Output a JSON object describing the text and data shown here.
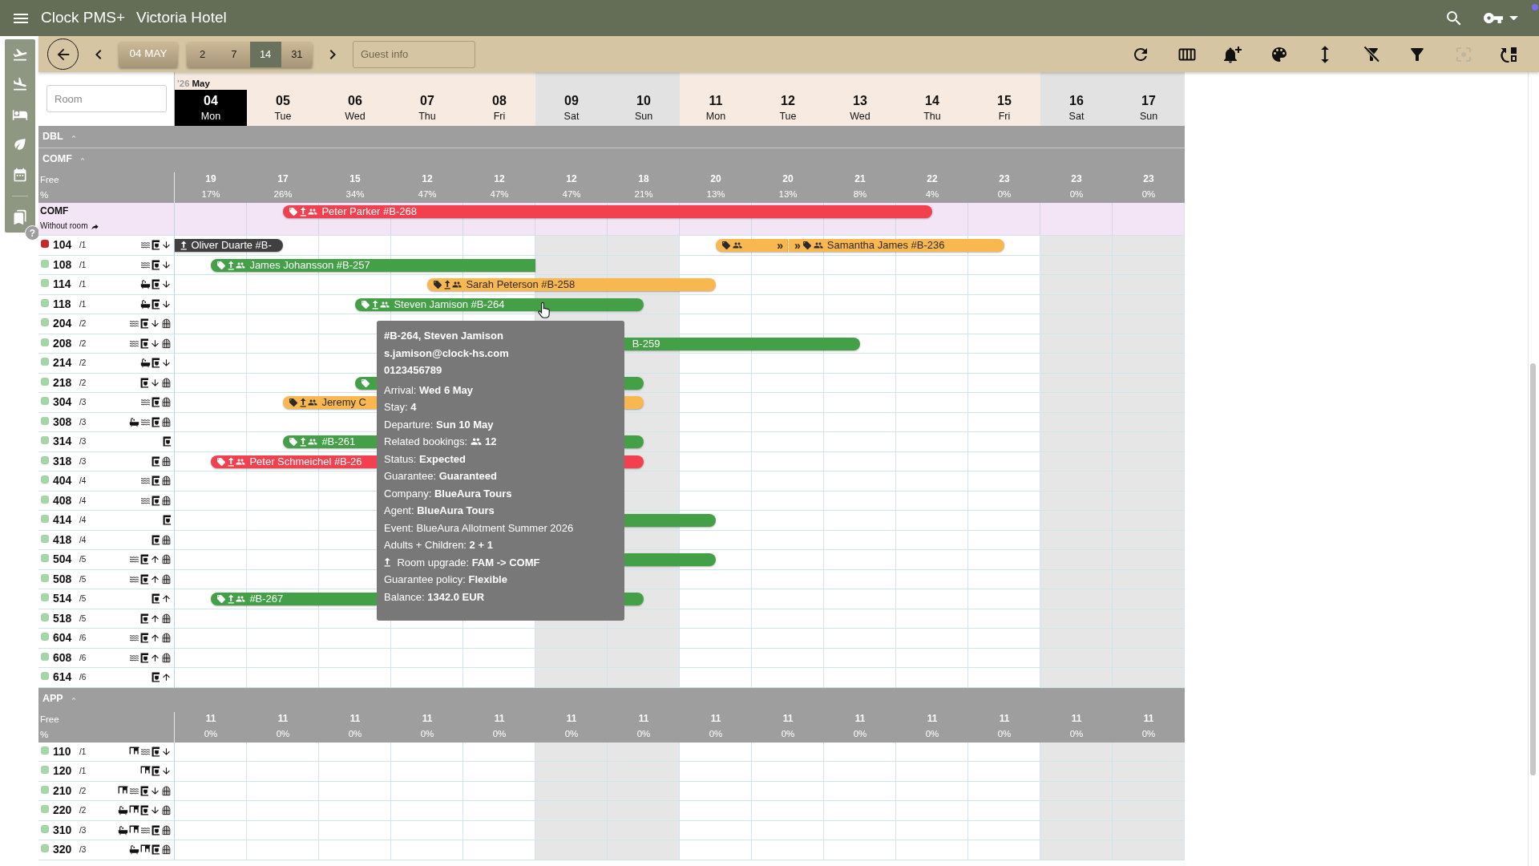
{
  "app_bar": {
    "title": "Clock PMS+",
    "hotel": "Victoria Hotel"
  },
  "sidebar": {
    "items": [
      {
        "kind": "departures"
      },
      {
        "kind": "arrivals"
      },
      {
        "kind": "bed"
      },
      {
        "kind": "leaf"
      },
      {
        "kind": "calendar"
      },
      {
        "kind": "books"
      }
    ],
    "help": "?"
  },
  "toolbar": {
    "date_button": "04 MAY",
    "ranges": [
      {
        "label": "2",
        "selected": false
      },
      {
        "label": "7",
        "selected": false
      },
      {
        "label": "14",
        "selected": true
      },
      {
        "label": "31",
        "selected": false
      }
    ],
    "guest_search": {
      "placeholder": "Guest info"
    },
    "tools": [
      {
        "kind": "refresh",
        "disabled": false
      },
      {
        "kind": "columns",
        "disabled": false
      },
      {
        "kind": "bell-plus",
        "disabled": false
      },
      {
        "kind": "palette",
        "disabled": false
      },
      {
        "kind": "vertical-arrows",
        "disabled": false
      },
      {
        "kind": "filter-off",
        "disabled": false
      },
      {
        "kind": "filter",
        "disabled": false
      },
      {
        "kind": "focus",
        "disabled": true
      },
      {
        "kind": "rotate-layout",
        "disabled": false
      }
    ]
  },
  "calendar": {
    "room_search": {
      "placeholder": "Room"
    },
    "year": "'26",
    "month": "May",
    "days": [
      {
        "day": "04",
        "weekday": "Mon",
        "selected": true,
        "weekend": false
      },
      {
        "day": "05",
        "weekday": "Tue",
        "selected": false,
        "weekend": false
      },
      {
        "day": "06",
        "weekday": "Wed",
        "selected": false,
        "weekend": false
      },
      {
        "day": "07",
        "weekday": "Thu",
        "selected": false,
        "weekend": false
      },
      {
        "day": "08",
        "weekday": "Fri",
        "selected": false,
        "weekend": false
      },
      {
        "day": "09",
        "weekday": "Sat",
        "selected": false,
        "weekend": true
      },
      {
        "day": "10",
        "weekday": "Sun",
        "selected": false,
        "weekend": true
      },
      {
        "day": "11",
        "weekday": "Mon",
        "selected": false,
        "weekend": false
      },
      {
        "day": "12",
        "weekday": "Tue",
        "selected": false,
        "weekend": false
      },
      {
        "day": "13",
        "weekday": "Wed",
        "selected": false,
        "weekend": false
      },
      {
        "day": "14",
        "weekday": "Thu",
        "selected": false,
        "weekend": false
      },
      {
        "day": "15",
        "weekday": "Fri",
        "selected": false,
        "weekend": false
      },
      {
        "day": "16",
        "weekday": "Sat",
        "selected": false,
        "weekend": true
      },
      {
        "day": "17",
        "weekday": "Sun",
        "selected": false,
        "weekend": true
      }
    ]
  },
  "groups": [
    {
      "name": "DBL"
    },
    {
      "name": "COMF",
      "availability": {
        "free_label": "Free",
        "percent_label": "%",
        "cells": [
          {
            "free": "19",
            "percent": "17%"
          },
          {
            "free": "17",
            "percent": "26%"
          },
          {
            "free": "15",
            "percent": "34%"
          },
          {
            "free": "12",
            "percent": "47%"
          },
          {
            "free": "12",
            "percent": "47%"
          },
          {
            "free": "12",
            "percent": "47%"
          },
          {
            "free": "18",
            "percent": "21%"
          },
          {
            "free": "20",
            "percent": "13%"
          },
          {
            "free": "20",
            "percent": "13%"
          },
          {
            "free": "21",
            "percent": "8%"
          },
          {
            "free": "22",
            "percent": "4%"
          },
          {
            "free": "23",
            "percent": "0%"
          },
          {
            "free": "23",
            "percent": "0%"
          },
          {
            "free": "23",
            "percent": "0%"
          }
        ]
      },
      "unassigned": {
        "title": "COMF",
        "subtitle": "Without room",
        "bookings": [
          {
            "label": "Peter Parker #B-268",
            "color": "#f2404e",
            "icons": [
              {
                "kind": "tag"
              },
              {
                "kind": "upgrade"
              },
              {
                "kind": "people"
              }
            ]
          }
        ]
      },
      "rooms": [
        {
          "number": "104",
          "floor": "/1",
          "color": "#c62828",
          "features": [
            {
              "kind": "waves"
            },
            {
              "kind": "coffee-maker"
            },
            {
              "kind": "arrow-down"
            }
          ],
          "bookings": [
            {
              "label": "Oliver Duarte #B-",
              "color": "#404040",
              "icons": [
                {
                  "kind": "upgrade"
                }
              ]
            },
            {
              "color": "#f9b84f",
              "icons": [
                {
                  "kind": "tag"
                },
                {
                  "kind": "people"
                }
              ],
              "end_mark": "»"
            },
            {
              "start_mark": "»",
              "color": "#f9b84f",
              "icons": [
                {
                  "kind": "tag"
                },
                {
                  "kind": "people"
                }
              ],
              "label": "Samantha James #B-236"
            }
          ]
        },
        {
          "number": "108",
          "floor": "/1",
          "color": "#a5d6a7",
          "features": [
            {
              "kind": "waves"
            },
            {
              "kind": "coffee-maker"
            },
            {
              "kind": "arrow-down"
            }
          ],
          "bookings": [
            {
              "label": "James Johansson #B-257",
              "color": "#43a047",
              "icons": [
                {
                  "kind": "tag"
                },
                {
                  "kind": "upgrade"
                },
                {
                  "kind": "people"
                }
              ]
            }
          ]
        },
        {
          "number": "114",
          "floor": "/1",
          "color": "#a5d6a7",
          "features": [
            {
              "kind": "bathtub"
            },
            {
              "kind": "coffee-maker"
            },
            {
              "kind": "arrow-down"
            }
          ],
          "bookings": [
            {
              "label": "Sarah Peterson #B-258",
              "color": "#f9b84f",
              "icons": [
                {
                  "kind": "tag"
                },
                {
                  "kind": "upgrade"
                },
                {
                  "kind": "people"
                }
              ]
            }
          ]
        },
        {
          "number": "118",
          "floor": "/1",
          "color": "#a5d6a7",
          "features": [
            {
              "kind": "bathtub"
            },
            {
              "kind": "coffee-maker"
            },
            {
              "kind": "arrow-down"
            }
          ],
          "bookings": [
            {
              "label": "Steven Jamison #B-264",
              "color": "#43a047",
              "icons": [
                {
                  "kind": "tag"
                },
                {
                  "kind": "upgrade"
                },
                {
                  "kind": "people"
                }
              ]
            }
          ]
        },
        {
          "number": "204",
          "floor": "/2",
          "color": "#a5d6a7",
          "features": [
            {
              "kind": "waves"
            },
            {
              "kind": "coffee-maker"
            },
            {
              "kind": "arrow-down"
            },
            {
              "kind": "window"
            }
          ]
        },
        {
          "number": "208",
          "floor": "/2",
          "color": "#a5d6a7",
          "features": [
            {
              "kind": "waves"
            },
            {
              "kind": "coffee-maker"
            },
            {
              "kind": "arrow-down"
            },
            {
              "kind": "window"
            }
          ],
          "bookings": [
            {
              "label": "B-259",
              "color": "#43a047"
            }
          ]
        },
        {
          "number": "214",
          "floor": "/2",
          "color": "#a5d6a7",
          "features": [
            {
              "kind": "bathtub"
            },
            {
              "kind": "coffee-maker"
            },
            {
              "kind": "arrow-down"
            }
          ]
        },
        {
          "number": "218",
          "floor": "/2",
          "color": "#a5d6a7",
          "features": [
            {
              "kind": "coffee-maker"
            },
            {
              "kind": "arrow-down"
            },
            {
              "kind": "window"
            }
          ],
          "bookings": [
            {
              "color": "#43a047",
              "icons": [
                {
                  "kind": "tag"
                }
              ]
            },
            {
              "color": "#43a047"
            }
          ]
        },
        {
          "number": "304",
          "floor": "/3",
          "color": "#a5d6a7",
          "features": [
            {
              "kind": "waves"
            },
            {
              "kind": "coffee-maker"
            },
            {
              "kind": "window"
            }
          ],
          "bookings": [
            {
              "label": "Jeremy C",
              "color": "#f9b84f",
              "icons": [
                {
                  "kind": "tag"
                },
                {
                  "kind": "upgrade"
                },
                {
                  "kind": "people"
                }
              ]
            },
            {
              "color": "#f9b84f"
            }
          ]
        },
        {
          "number": "308",
          "floor": "/3",
          "color": "#a5d6a7",
          "features": [
            {
              "kind": "bathtub"
            },
            {
              "kind": "waves"
            },
            {
              "kind": "coffee-maker"
            },
            {
              "kind": "window"
            }
          ]
        },
        {
          "number": "314",
          "floor": "/3",
          "color": "#a5d6a7",
          "features": [
            {
              "kind": "coffee-maker"
            }
          ],
          "bookings": [
            {
              "label": "#B-261",
              "color": "#43a047",
              "icons": [
                {
                  "kind": "tag"
                },
                {
                  "kind": "upgrade"
                },
                {
                  "kind": "people"
                }
              ]
            },
            {
              "color": "#43a047"
            }
          ]
        },
        {
          "number": "318",
          "floor": "/3",
          "color": "#a5d6a7",
          "features": [
            {
              "kind": "coffee-maker"
            },
            {
              "kind": "window"
            }
          ],
          "bookings": [
            {
              "label": "Peter Schmeichel #B-26",
              "color": "#f2404e",
              "icons": [
                {
                  "kind": "tag"
                },
                {
                  "kind": "upgrade"
                },
                {
                  "kind": "people"
                }
              ]
            },
            {
              "color": "#f2404e"
            }
          ]
        },
        {
          "number": "404",
          "floor": "/4",
          "color": "#a5d6a7",
          "features": [
            {
              "kind": "waves"
            },
            {
              "kind": "coffee-maker"
            },
            {
              "kind": "window"
            }
          ]
        },
        {
          "number": "408",
          "floor": "/4",
          "color": "#a5d6a7",
          "features": [
            {
              "kind": "waves"
            },
            {
              "kind": "coffee-maker"
            },
            {
              "kind": "window"
            }
          ]
        },
        {
          "number": "414",
          "floor": "/4",
          "color": "#a5d6a7",
          "features": [
            {
              "kind": "coffee-maker"
            }
          ],
          "bookings": [
            {
              "color": "#43a047"
            }
          ]
        },
        {
          "number": "418",
          "floor": "/4",
          "color": "#a5d6a7",
          "features": [
            {
              "kind": "coffee-maker"
            },
            {
              "kind": "window"
            }
          ]
        },
        {
          "number": "504",
          "floor": "/5",
          "color": "#a5d6a7",
          "features": [
            {
              "kind": "waves"
            },
            {
              "kind": "coffee-maker"
            },
            {
              "kind": "arrow-up"
            },
            {
              "kind": "window"
            }
          ],
          "bookings": [
            {
              "color": "#43a047"
            }
          ]
        },
        {
          "number": "508",
          "floor": "/5",
          "color": "#a5d6a7",
          "features": [
            {
              "kind": "waves"
            },
            {
              "kind": "coffee-maker"
            },
            {
              "kind": "arrow-up"
            },
            {
              "kind": "window"
            }
          ]
        },
        {
          "number": "514",
          "floor": "/5",
          "color": "#a5d6a7",
          "features": [
            {
              "kind": "coffee-maker"
            },
            {
              "kind": "arrow-up"
            }
          ],
          "bookings": [
            {
              "label": "#B-267",
              "color": "#43a047",
              "icons": [
                {
                  "kind": "tag"
                },
                {
                  "kind": "upgrade"
                },
                {
                  "kind": "people"
                }
              ]
            },
            {
              "color": "#43a047"
            }
          ]
        },
        {
          "number": "518",
          "floor": "/5",
          "color": "#a5d6a7",
          "features": [
            {
              "kind": "coffee-maker"
            },
            {
              "kind": "arrow-up"
            },
            {
              "kind": "window"
            }
          ]
        },
        {
          "number": "604",
          "floor": "/6",
          "color": "#a5d6a7",
          "features": [
            {
              "kind": "waves"
            },
            {
              "kind": "coffee-maker"
            },
            {
              "kind": "arrow-up"
            },
            {
              "kind": "window"
            }
          ]
        },
        {
          "number": "608",
          "floor": "/6",
          "color": "#a5d6a7",
          "features": [
            {
              "kind": "waves"
            },
            {
              "kind": "coffee-maker"
            },
            {
              "kind": "arrow-up"
            },
            {
              "kind": "window"
            }
          ]
        },
        {
          "number": "614",
          "floor": "/6",
          "color": "#a5d6a7",
          "features": [
            {
              "kind": "coffee-maker"
            },
            {
              "kind": "arrow-up"
            }
          ]
        }
      ]
    },
    {
      "name": "APP",
      "availability": {
        "free_label": "Free",
        "percent_label": "%",
        "cells": [
          {
            "free": "11",
            "percent": "0%"
          },
          {
            "free": "11",
            "percent": "0%"
          },
          {
            "free": "11",
            "percent": "0%"
          },
          {
            "free": "11",
            "percent": "0%"
          },
          {
            "free": "11",
            "percent": "0%"
          },
          {
            "free": "11",
            "percent": "0%"
          },
          {
            "free": "11",
            "percent": "0%"
          },
          {
            "free": "11",
            "percent": "0%"
          },
          {
            "free": "11",
            "percent": "0%"
          },
          {
            "free": "11",
            "percent": "0%"
          },
          {
            "free": "11",
            "percent": "0%"
          },
          {
            "free": "11",
            "percent": "0%"
          },
          {
            "free": "11",
            "percent": "0%"
          },
          {
            "free": "11",
            "percent": "0%"
          }
        ]
      },
      "rooms": [
        {
          "number": "110",
          "floor": "/1",
          "color": "#a5d6a7",
          "features": [
            {
              "kind": "desk"
            },
            {
              "kind": "waves"
            },
            {
              "kind": "coffee-maker"
            },
            {
              "kind": "arrow-down"
            }
          ]
        },
        {
          "number": "120",
          "floor": "/1",
          "color": "#a5d6a7",
          "features": [
            {
              "kind": "desk"
            },
            {
              "kind": "coffee-maker"
            },
            {
              "kind": "arrow-down"
            }
          ]
        },
        {
          "number": "210",
          "floor": "/2",
          "color": "#a5d6a7",
          "features": [
            {
              "kind": "desk"
            },
            {
              "kind": "waves"
            },
            {
              "kind": "coffee-maker"
            },
            {
              "kind": "arrow-down"
            },
            {
              "kind": "window"
            }
          ]
        },
        {
          "number": "220",
          "floor": "/2",
          "color": "#a5d6a7",
          "features": [
            {
              "kind": "bathtub"
            },
            {
              "kind": "desk"
            },
            {
              "kind": "coffee-maker"
            },
            {
              "kind": "arrow-down"
            },
            {
              "kind": "window"
            }
          ]
        },
        {
          "number": "310",
          "floor": "/3",
          "color": "#a5d6a7",
          "features": [
            {
              "kind": "bathtub"
            },
            {
              "kind": "desk"
            },
            {
              "kind": "waves"
            },
            {
              "kind": "coffee-maker"
            },
            {
              "kind": "window"
            }
          ]
        },
        {
          "number": "320",
          "floor": "/3",
          "color": "#a5d6a7",
          "features": [
            {
              "kind": "bathtub"
            },
            {
              "kind": "desk"
            },
            {
              "kind": "coffee-maker"
            },
            {
              "kind": "window"
            }
          ]
        }
      ]
    }
  ],
  "tooltip": {
    "title_lines": [
      "#B-264, Steven Jamison",
      "s.jamison@clock-hs.com",
      "0123456789"
    ],
    "lines": [
      {
        "kind": "text",
        "text": "Arrival: **Wed 6 May**"
      },
      {
        "kind": "text",
        "text": "Stay: **4**"
      },
      {
        "kind": "text",
        "text": "Departure: **Sun 10 May**"
      },
      {
        "kind": "count",
        "text": "Related bookings:",
        "value": "12"
      },
      {
        "kind": "text",
        "text": "Status: **Expected**"
      },
      {
        "kind": "text",
        "text": "Guarantee: **Guaranteed**"
      },
      {
        "kind": "text",
        "text": "Company: **BlueAura Tours**"
      },
      {
        "kind": "text",
        "text": "Agent: **BlueAura Tours**"
      },
      {
        "kind": "text",
        "text": "Event: BlueAura Allotment Summer 2026"
      },
      {
        "kind": "text",
        "text": "Adults + Children: **2 + 1**"
      },
      {
        "kind": "upgrade",
        "text": "Room upgrade: **FAM -> COMF**"
      },
      {
        "kind": "text",
        "text": "Guarantee policy: **Flexible**"
      },
      {
        "kind": "text",
        "text": "Balance: **1342.0 EUR**"
      }
    ]
  }
}
